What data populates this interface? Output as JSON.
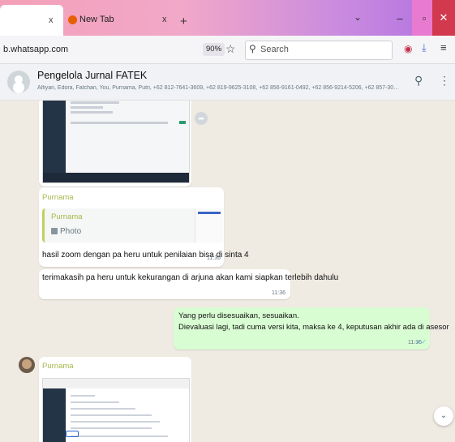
{
  "browser": {
    "tabs": [
      {
        "label": "",
        "close": "x"
      },
      {
        "label": "New Tab",
        "close": "x"
      }
    ],
    "new_tab": "+",
    "list_all_tabs": "⌄",
    "window_controls": {
      "minimize": "–",
      "maximize": "▫",
      "close": "✕"
    },
    "url": "b.whatsapp.com",
    "zoom": "90%",
    "search_placeholder": "Search",
    "colors": {
      "accent_tab_close": "#d2384e",
      "maximize_hover": "#e87bd0"
    }
  },
  "chat_header": {
    "group_name": "Pengelola Jurnal FATEK",
    "members": "Alfiyan, Edora, Fatchan, You, Purnama, Putri, +62 812-7641-3609, +62 819-9625-3108, +62 856-9161-0492, +62 856-9214-5206, +62 857-3030-4025, +62 8..."
  },
  "messages": {
    "m1": {
      "type": "image"
    },
    "m2": {
      "sender": "Purnama",
      "quoted_sender": "Purnama",
      "quoted_type": "Photo",
      "text": "hasil zoom dengan pa heru untuk penilaian bisa di sinta 4",
      "time": "11:36"
    },
    "m3": {
      "text": "terimakasih pa heru untuk kekurangan di arjuna akan kami siapkan terlebih dahulu",
      "time": "11:36"
    },
    "m4": {
      "line1": "Yang perlu disesuaikan, sesuaikan.",
      "line2": "Dievaluasi lagi, tadi cuma versi kita, maksa ke 4, keputusan akhir ada di asesor",
      "time": "11:36",
      "status": "✓✓"
    },
    "m5": {
      "sender": "Purnama",
      "type": "image"
    }
  },
  "icons": {
    "forward": "forward-icon",
    "scroll_down": "chevron-down-icon"
  },
  "colors": {
    "chat_bg": "#efeae2",
    "outgoing": "#d9fdd3",
    "sender_name": "#a4b84a",
    "read_tick": "#53bdeb"
  }
}
